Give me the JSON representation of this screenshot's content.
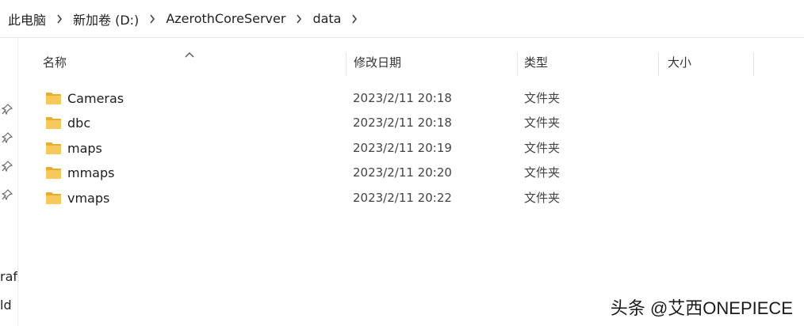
{
  "breadcrumb": [
    "此电脑",
    "新加卷 (D:)",
    "AzerothCoreServer",
    "data"
  ],
  "columns": {
    "name": "名称",
    "modified": "修改日期",
    "type": "类型",
    "size": "大小"
  },
  "files": [
    {
      "name": "Cameras",
      "modified": "2023/2/11 20:18",
      "type": "文件夹"
    },
    {
      "name": "dbc",
      "modified": "2023/2/11 20:18",
      "type": "文件夹"
    },
    {
      "name": "maps",
      "modified": "2023/2/11 20:19",
      "type": "文件夹"
    },
    {
      "name": "mmaps",
      "modified": "2023/2/11 20:20",
      "type": "文件夹"
    },
    {
      "name": "vmaps",
      "modified": "2023/2/11 20:22",
      "type": "文件夹"
    }
  ],
  "left_pane": {
    "pinned_icon": "pin-icon",
    "partial_labels": [
      "raf",
      "ld"
    ]
  },
  "watermark": "头条 @艾西ONEPIECE",
  "colors": {
    "folder": "#f7c85a",
    "folder_dark": "#e7ad2e"
  }
}
